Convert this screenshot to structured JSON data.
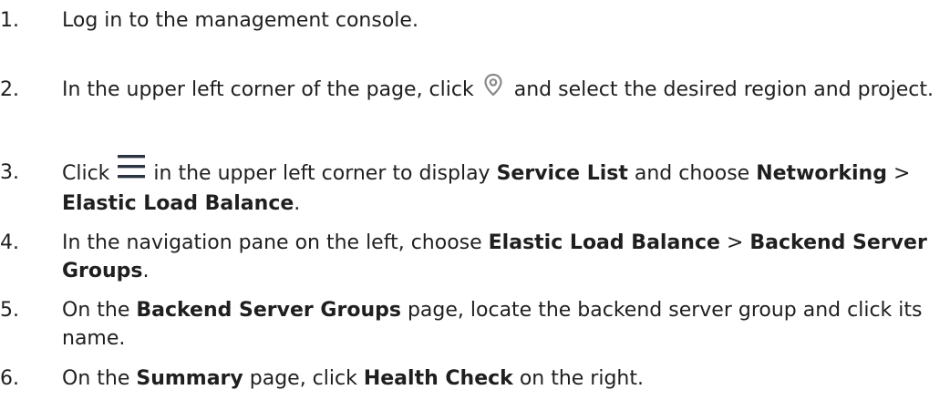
{
  "steps": [
    {
      "num": "1.",
      "text": "Log in to the management console."
    },
    {
      "num": "2.",
      "pre": "In the upper left corner of the page, click",
      "icon": "location-pin-icon",
      "post": "and select the desired region and project."
    },
    {
      "num": "3.",
      "pre": "Click",
      "icon": "menu-hamburger-icon",
      "mid": "in the upper left corner to display",
      "b1": "Service List",
      "t1": "and choose",
      "b2": "Networking",
      "sep": ">",
      "b3": "Elastic Load Balance",
      "end": "."
    },
    {
      "num": "4.",
      "pre": "In the navigation pane on the left, choose",
      "b1": "Elastic Load Balance",
      "sep": ">",
      "b2": "Backend Server Groups",
      "end": "."
    },
    {
      "num": "5.",
      "pre": "On the",
      "b1": "Backend Server Groups",
      "post": "page, locate the backend server group and click its name."
    },
    {
      "num": "6.",
      "pre": "On the",
      "b1": "Summary",
      "mid": "page, click",
      "b2": "Health Check",
      "post": "on the right."
    }
  ],
  "colors": {
    "text": "#1f1f1f",
    "icon": "#8a8a8a",
    "menu_icon": "#2b3440",
    "background": "#ffffff"
  }
}
